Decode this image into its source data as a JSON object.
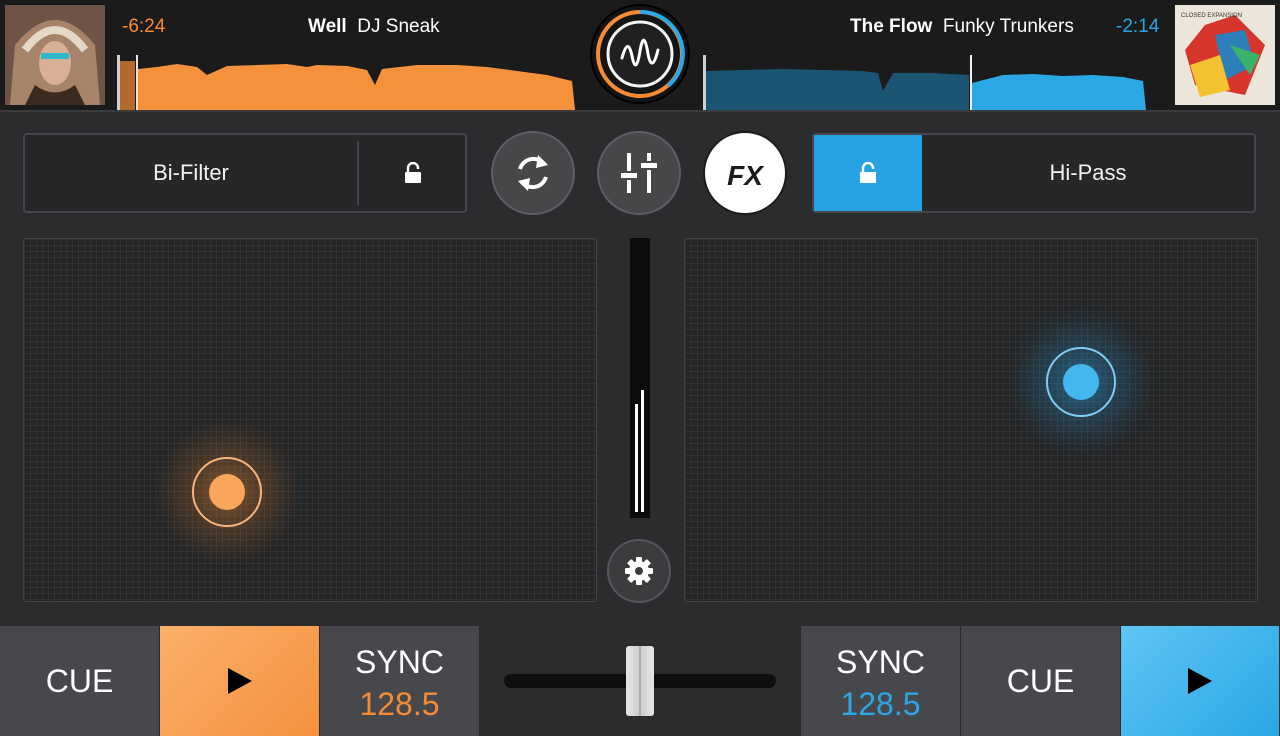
{
  "deck_left": {
    "time_remaining": "-6:24",
    "track_title": "Well",
    "artist": "DJ Sneak",
    "accent_color": "#f58b34",
    "fx_name": "Bi-Filter",
    "bpm": "128.5",
    "cue_label": "CUE",
    "sync_label": "SYNC"
  },
  "deck_right": {
    "time_remaining": "-2:14",
    "track_title": "The Flow",
    "artist": "Funky Trunkers",
    "accent_color": "#2ba7e6",
    "fx_name": "Hi-Pass",
    "bpm": "128.5",
    "cue_label": "CUE",
    "sync_label": "SYNC"
  },
  "center": {
    "fx_button_label": "FX",
    "crossfader_position": 0.5,
    "meter_levels": [
      0.4,
      0.45
    ]
  },
  "art_right_text": "CLOSED EXPANSION",
  "icons": [
    "lock-icon",
    "loop-icon",
    "mixer-icon",
    "settings-icon",
    "play-icon",
    "app-logo-icon"
  ]
}
